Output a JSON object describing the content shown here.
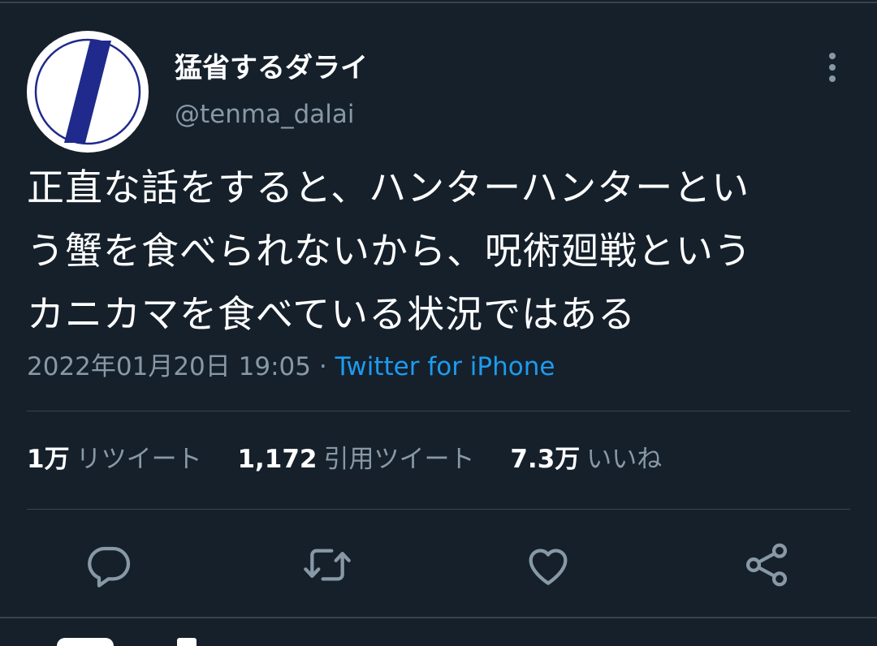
{
  "user": {
    "display_name": "猛省するダライ",
    "handle": "@tenma_dalai"
  },
  "tweet": {
    "text_lines": [
      "正直な話をすると、ハンターハンターとい",
      "う蟹を食べられないから、呪術廻戦という",
      "カニカマを食べている状況ではある"
    ],
    "timestamp": "2022年01月20日 19:05",
    "separator": "·",
    "source": "Twitter for iPhone"
  },
  "stats": {
    "retweets": {
      "count": "1万",
      "label": "リツイート"
    },
    "quotes": {
      "count": "1,172",
      "label": "引用ツイート"
    },
    "likes": {
      "count": "7.3万",
      "label": "いいね"
    }
  },
  "actions": {
    "reply_icon": "reply-icon",
    "retweet_icon": "retweet-icon",
    "like_icon": "heart-icon",
    "share_icon": "share-icon"
  },
  "colors": {
    "background": "#15202b",
    "secondary_text": "#8899a6",
    "link": "#1d9bf0",
    "divider": "#38444d",
    "avatar_stripe": "#1f2a8c"
  }
}
